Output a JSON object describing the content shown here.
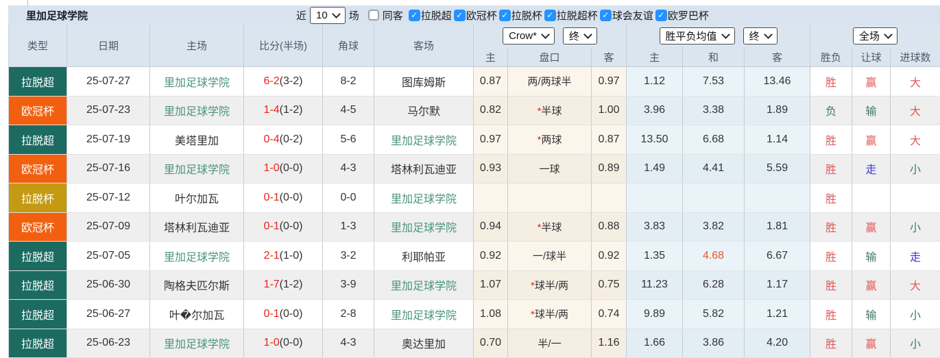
{
  "icons": {
    "check": "✓"
  },
  "toolbar": {
    "title": "里加足球学院",
    "near_label": "近",
    "recent_count": "10",
    "matches_label": "场",
    "same_opponent_label": "同客",
    "filters": [
      {
        "label": "拉脱超",
        "checked": true
      },
      {
        "label": "欧冠杯",
        "checked": true
      },
      {
        "label": "拉脱杯",
        "checked": true
      },
      {
        "label": "拉脱超杯",
        "checked": true
      },
      {
        "label": "球会友谊",
        "checked": true
      },
      {
        "label": "欧罗巴杯",
        "checked": true
      }
    ]
  },
  "table": {
    "headers": {
      "type": "类型",
      "date": "日期",
      "home": "主场",
      "score": "比分(半场)",
      "corner": "角球",
      "away": "客场",
      "odds_home": "主",
      "handicap": "盘口",
      "odds_away": "客",
      "avg_home": "主",
      "avg_draw": "和",
      "avg_away": "客",
      "result_wdl": "胜负",
      "result_handicap": "让球",
      "result_goals": "进球数"
    },
    "selects": {
      "provider": "Crow*",
      "provider_time": "终",
      "avg_label": "胜平负均值",
      "avg_time": "终",
      "scope": "全场"
    }
  },
  "colors": {
    "badge_teal": "#1b6b61",
    "badge_orange": "#f2600f",
    "badge_gold": "#c49a12",
    "score_red": "#e8231a",
    "team_green": "#4a9478",
    "result_red": "#e25757",
    "result_green": "#3e7d63",
    "result_blue": "#4136d6",
    "hot_orange": "#e8562e",
    "checkbox_blue": "#2492ff"
  },
  "matches": [
    {
      "type": "拉脱超",
      "type_color": "bteal",
      "date": "25-07-27",
      "home": "里加足球学院",
      "home_c": "green",
      "score": "6-2",
      "half": "(3-2)",
      "corner": "8-2",
      "away": "图库姆斯",
      "away_c": "",
      "odds_home": "0.87",
      "pan_star": "",
      "pan": "两/两球半",
      "odds_away": "0.97",
      "avg_home": "1.12",
      "avg_draw": "7.53",
      "avg_draw_c": "",
      "avg_away": "13.46",
      "r_wdl": "胜",
      "r_wdl_c": "red",
      "r_pan": "赢",
      "r_pan_c": "red",
      "r_goal": "大",
      "r_goal_c": "red"
    },
    {
      "type": "欧冠杯",
      "type_color": "borange",
      "date": "25-07-23",
      "home": "里加足球学院",
      "home_c": "green",
      "score": "1-4",
      "half": "(1-2)",
      "corner": "4-5",
      "away": "马尔默",
      "away_c": "",
      "odds_home": "0.82",
      "pan_star": "*",
      "pan": "半球",
      "odds_away": "1.00",
      "avg_home": "3.96",
      "avg_draw": "3.38",
      "avg_draw_c": "",
      "avg_away": "1.89",
      "r_wdl": "负",
      "r_wdl_c": "dgreen",
      "r_pan": "输",
      "r_pan_c": "dgreen",
      "r_goal": "大",
      "r_goal_c": "red"
    },
    {
      "type": "拉脱超",
      "type_color": "bteal",
      "date": "25-07-19",
      "home": "美塔里加",
      "home_c": "",
      "score": "0-4",
      "half": "(0-2)",
      "corner": "5-6",
      "away": "里加足球学院",
      "away_c": "green",
      "odds_home": "0.97",
      "pan_star": "*",
      "pan": "两球",
      "odds_away": "0.87",
      "avg_home": "13.50",
      "avg_draw": "6.68",
      "avg_draw_c": "",
      "avg_away": "1.14",
      "r_wdl": "胜",
      "r_wdl_c": "red",
      "r_pan": "赢",
      "r_pan_c": "red",
      "r_goal": "大",
      "r_goal_c": "red"
    },
    {
      "type": "欧冠杯",
      "type_color": "borange",
      "date": "25-07-16",
      "home": "里加足球学院",
      "home_c": "green",
      "score": "1-0",
      "half": "(0-0)",
      "corner": "4-3",
      "away": "塔林利瓦迪亚",
      "away_c": "",
      "odds_home": "0.93",
      "pan_star": "",
      "pan": "一球",
      "odds_away": "0.89",
      "avg_home": "1.49",
      "avg_draw": "4.41",
      "avg_draw_c": "",
      "avg_away": "5.59",
      "r_wdl": "胜",
      "r_wdl_c": "red",
      "r_pan": "走",
      "r_pan_c": "blue",
      "r_goal": "小",
      "r_goal_c": "dgreen"
    },
    {
      "type": "拉脱杯",
      "type_color": "bgold",
      "date": "25-07-12",
      "home": "叶尔加瓦",
      "home_c": "",
      "score": "0-1",
      "half": "(0-0)",
      "corner": "0-0",
      "away": "里加足球学院",
      "away_c": "green",
      "odds_home": "",
      "pan_star": "",
      "pan": "",
      "odds_away": "",
      "avg_home": "",
      "avg_draw": "",
      "avg_draw_c": "",
      "avg_away": "",
      "r_wdl": "胜",
      "r_wdl_c": "red",
      "r_pan": "",
      "r_pan_c": "",
      "r_goal": "",
      "r_goal_c": ""
    },
    {
      "type": "欧冠杯",
      "type_color": "borange",
      "date": "25-07-09",
      "home": "塔林利瓦迪亚",
      "home_c": "",
      "score": "0-1",
      "half": "(0-0)",
      "corner": "1-3",
      "away": "里加足球学院",
      "away_c": "green",
      "odds_home": "0.94",
      "pan_star": "*",
      "pan": "半球",
      "odds_away": "0.88",
      "avg_home": "3.83",
      "avg_draw": "3.82",
      "avg_draw_c": "",
      "avg_away": "1.81",
      "r_wdl": "胜",
      "r_wdl_c": "red",
      "r_pan": "赢",
      "r_pan_c": "red",
      "r_goal": "小",
      "r_goal_c": "dgreen"
    },
    {
      "type": "拉脱超",
      "type_color": "bteal",
      "date": "25-07-05",
      "home": "里加足球学院",
      "home_c": "green",
      "score": "2-1",
      "half": "(1-0)",
      "corner": "3-2",
      "away": "利耶帕亚",
      "away_c": "",
      "odds_home": "0.92",
      "pan_star": "",
      "pan": "一/球半",
      "odds_away": "0.92",
      "avg_home": "1.35",
      "avg_draw": "4.68",
      "avg_draw_c": "orange",
      "avg_away": "6.67",
      "r_wdl": "胜",
      "r_wdl_c": "red",
      "r_pan": "输",
      "r_pan_c": "dgreen",
      "r_goal": "走",
      "r_goal_c": "blue"
    },
    {
      "type": "拉脱超",
      "type_color": "bteal",
      "date": "25-06-30",
      "home": "陶格夫匹尔斯",
      "home_c": "",
      "score": "1-7",
      "half": "(1-2)",
      "corner": "3-9",
      "away": "里加足球学院",
      "away_c": "green",
      "odds_home": "1.07",
      "pan_star": "*",
      "pan": "球半/两",
      "odds_away": "0.75",
      "avg_home": "11.23",
      "avg_draw": "6.28",
      "avg_draw_c": "",
      "avg_away": "1.17",
      "r_wdl": "胜",
      "r_wdl_c": "red",
      "r_pan": "赢",
      "r_pan_c": "red",
      "r_goal": "大",
      "r_goal_c": "red"
    },
    {
      "type": "拉脱超",
      "type_color": "bteal",
      "date": "25-06-27",
      "home": "叶�尔加瓦",
      "home_c": "",
      "score": "0-1",
      "half": "(0-0)",
      "corner": "2-8",
      "away": "里加足球学院",
      "away_c": "green",
      "odds_home": "1.08",
      "pan_star": "*",
      "pan": "球半/两",
      "odds_away": "0.74",
      "avg_home": "9.89",
      "avg_draw": "5.82",
      "avg_draw_c": "",
      "avg_away": "1.21",
      "r_wdl": "胜",
      "r_wdl_c": "red",
      "r_pan": "输",
      "r_pan_c": "dgreen",
      "r_goal": "小",
      "r_goal_c": "dgreen"
    },
    {
      "type": "拉脱超",
      "type_color": "bteal",
      "date": "25-06-23",
      "home": "里加足球学院",
      "home_c": "green",
      "score": "1-0",
      "half": "(0-0)",
      "corner": "4-3",
      "away": "奥达里加",
      "away_c": "",
      "odds_home": "0.70",
      "pan_star": "",
      "pan": "半/一",
      "odds_away": "1.16",
      "avg_home": "1.66",
      "avg_draw": "3.86",
      "avg_draw_c": "",
      "avg_away": "4.20",
      "r_wdl": "胜",
      "r_wdl_c": "red",
      "r_pan": "赢",
      "r_pan_c": "red",
      "r_goal": "小",
      "r_goal_c": "dgreen"
    }
  ]
}
